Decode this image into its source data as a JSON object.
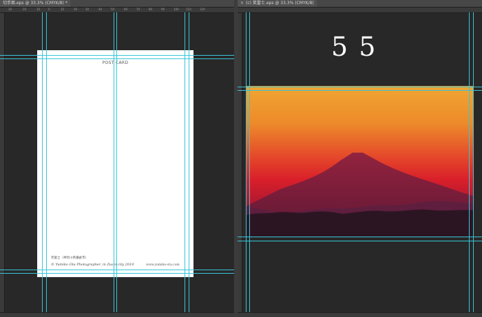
{
  "left_doc": {
    "tab_title": "切手面.eps @ 33.3% (CMYK/8) *",
    "ruler_numbers": [
      "30",
      "20",
      "10",
      "0",
      "10",
      "20",
      "30",
      "40",
      "50",
      "60",
      "70",
      "80",
      "90",
      "100",
      "110",
      "120"
    ],
    "postcard": {
      "title": "POST CARD",
      "caption": "笑富士（神奈川県鎌倉市）",
      "credit": "© Yumiko Ota Photographer, in Zushi city 2010",
      "website": "www.yumiko-ota.com"
    }
  },
  "right_doc": {
    "tab_title": "(c) 笑富士.eps @ 33.3% (CMYK/8)",
    "page_number": "5 5",
    "photo": {
      "subject": "Mount Fuji silhouette at sunset"
    }
  },
  "icons": {
    "close": "close-icon"
  },
  "colors": {
    "guide": "#37c6d8",
    "canvas": "#282828",
    "sky_top": "#f0a030",
    "sky_mid": "#e02824",
    "mountain": "#6a1d3a"
  }
}
